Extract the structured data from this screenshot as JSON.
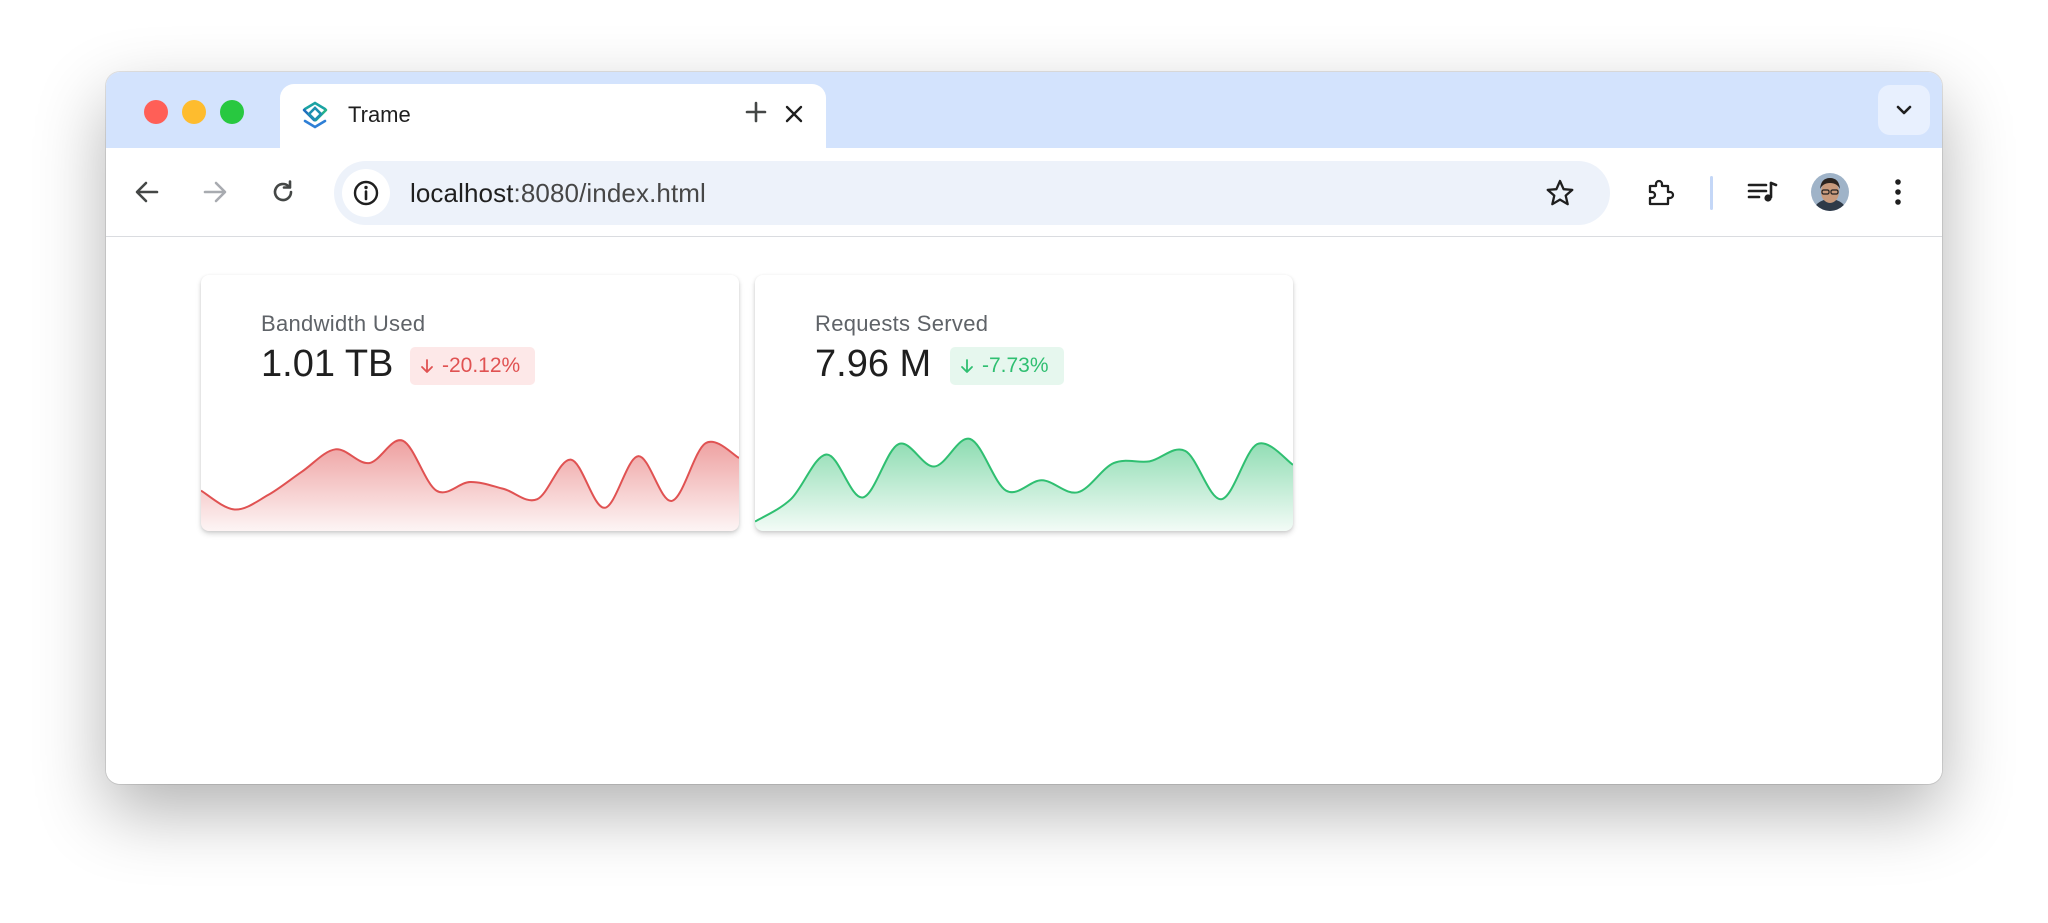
{
  "browser": {
    "tab_title": "Trame",
    "url_host": "localhost",
    "url_rest": ":8080/index.html",
    "accent": "#d3e3fd"
  },
  "icons": {
    "close": "close-icon",
    "new_tab": "plus-icon",
    "tab_menu": "chevron-down-icon",
    "back": "arrow-left-icon",
    "forward": "arrow-right-icon",
    "reload": "reload-icon",
    "site_info": "info-icon",
    "bookmark": "star-icon",
    "extensions": "puzzle-icon",
    "media": "playlist-icon",
    "profile": "avatar",
    "menu": "kebab-menu-icon"
  },
  "cards": [
    {
      "label": "Bandwidth Used",
      "value": "1.01 TB",
      "delta": "-20.12%",
      "delta_direction": "down",
      "color": "#e05252",
      "badge_bg": "#fde8e8",
      "sparkline": [
        0.4,
        0.18,
        0.35,
        0.62,
        0.88,
        0.72,
        0.98,
        0.4,
        0.5,
        0.42,
        0.3,
        0.76,
        0.2,
        0.8,
        0.28,
        0.95,
        0.78
      ]
    },
    {
      "label": "Requests Served",
      "value": "7.96 M",
      "delta": "-7.73%",
      "delta_direction": "down",
      "color": "#2fbf71",
      "badge_bg": "#e6f7ee",
      "sparkline": [
        0.04,
        0.3,
        0.82,
        0.32,
        0.94,
        0.68,
        1.0,
        0.4,
        0.52,
        0.38,
        0.72,
        0.74,
        0.86,
        0.3,
        0.94,
        0.7
      ]
    }
  ]
}
